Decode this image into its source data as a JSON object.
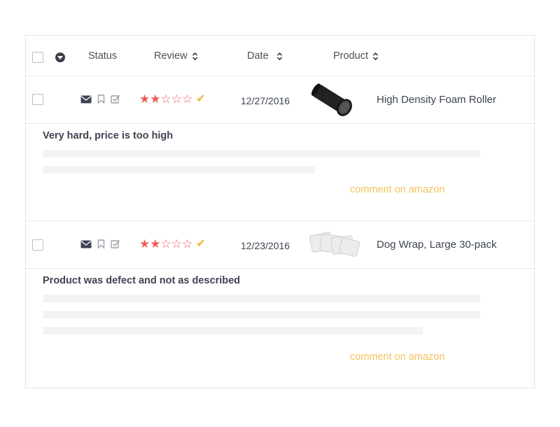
{
  "header": {
    "status_label": "Status",
    "review_label": "Review",
    "date_label": "Date",
    "product_label": "Product"
  },
  "reviews": [
    {
      "date": "12/27/2016",
      "product": "High Density Foam Roller",
      "rating": 2,
      "rating_max": 5,
      "comment": "Very hard, price is too high",
      "link": "comment on amazon",
      "thumbnail_icon": "foam-roller-image"
    },
    {
      "date": "12/23/2016",
      "product": "Dog Wrap, Large 30-pack",
      "rating": 2,
      "rating_max": 5,
      "comment": "Product was defect and not as described",
      "link": "comment on amazon",
      "thumbnail_icon": "dog-wrap-image"
    }
  ],
  "colors": {
    "star": "#ef5a55",
    "check": "#f0b53a",
    "link": "#f3c25a",
    "placeholder": "#f2f3f5"
  }
}
